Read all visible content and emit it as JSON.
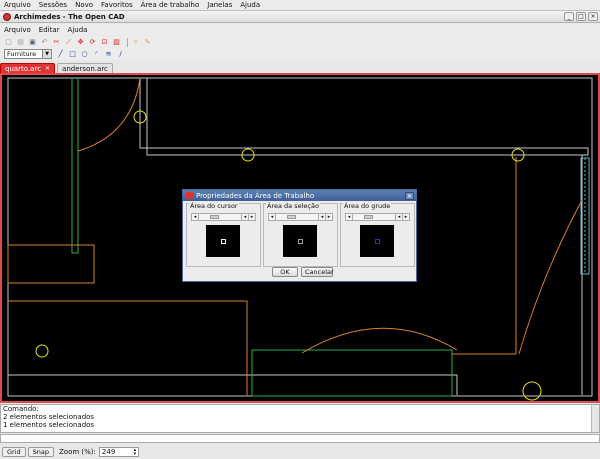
{
  "desktop_menu": {
    "items": [
      "Arquivo",
      "Sessões",
      "Novo",
      "Favoritos",
      "Área de trabalho",
      "Janelas",
      "Ajuda"
    ]
  },
  "window": {
    "title": "Archimedes - The Open CAD"
  },
  "menubar": {
    "items": [
      "Arquivo",
      "Editar",
      "Ajuda"
    ]
  },
  "toolbar": {
    "layer": "Furniture"
  },
  "tabs": [
    {
      "label": "quarto.arc",
      "active": true
    },
    {
      "label": "anderson.arc",
      "active": false
    }
  ],
  "dialog": {
    "title": "Propriedades da Área de Trabalho",
    "groups": [
      {
        "label": "Área do cursor",
        "mark_color": "#ffffff"
      },
      {
        "label": "Área da seleção",
        "mark_color": "#9aa0a8"
      },
      {
        "label": "Área do grude",
        "mark_color": "#2233cc"
      }
    ],
    "ok_label": "OK",
    "cancel_label": "Cancelar"
  },
  "console": {
    "lines": [
      "Comando:",
      "2 elementos selecionados",
      "1 elementos selecionados"
    ]
  },
  "statusbar": {
    "grid_label": "Grid",
    "snap_label": "Snap",
    "zoom_label": "Zoom (%):",
    "zoom_value": "249"
  },
  "colors": {
    "accent_red": "#e03434",
    "dialog_title_blue": "#4a6b9a",
    "wall_gray": "#c8c8c8",
    "furniture_orange": "#d9822b",
    "green_line": "#2fae4a",
    "yellow_circle": "#e8e020"
  }
}
